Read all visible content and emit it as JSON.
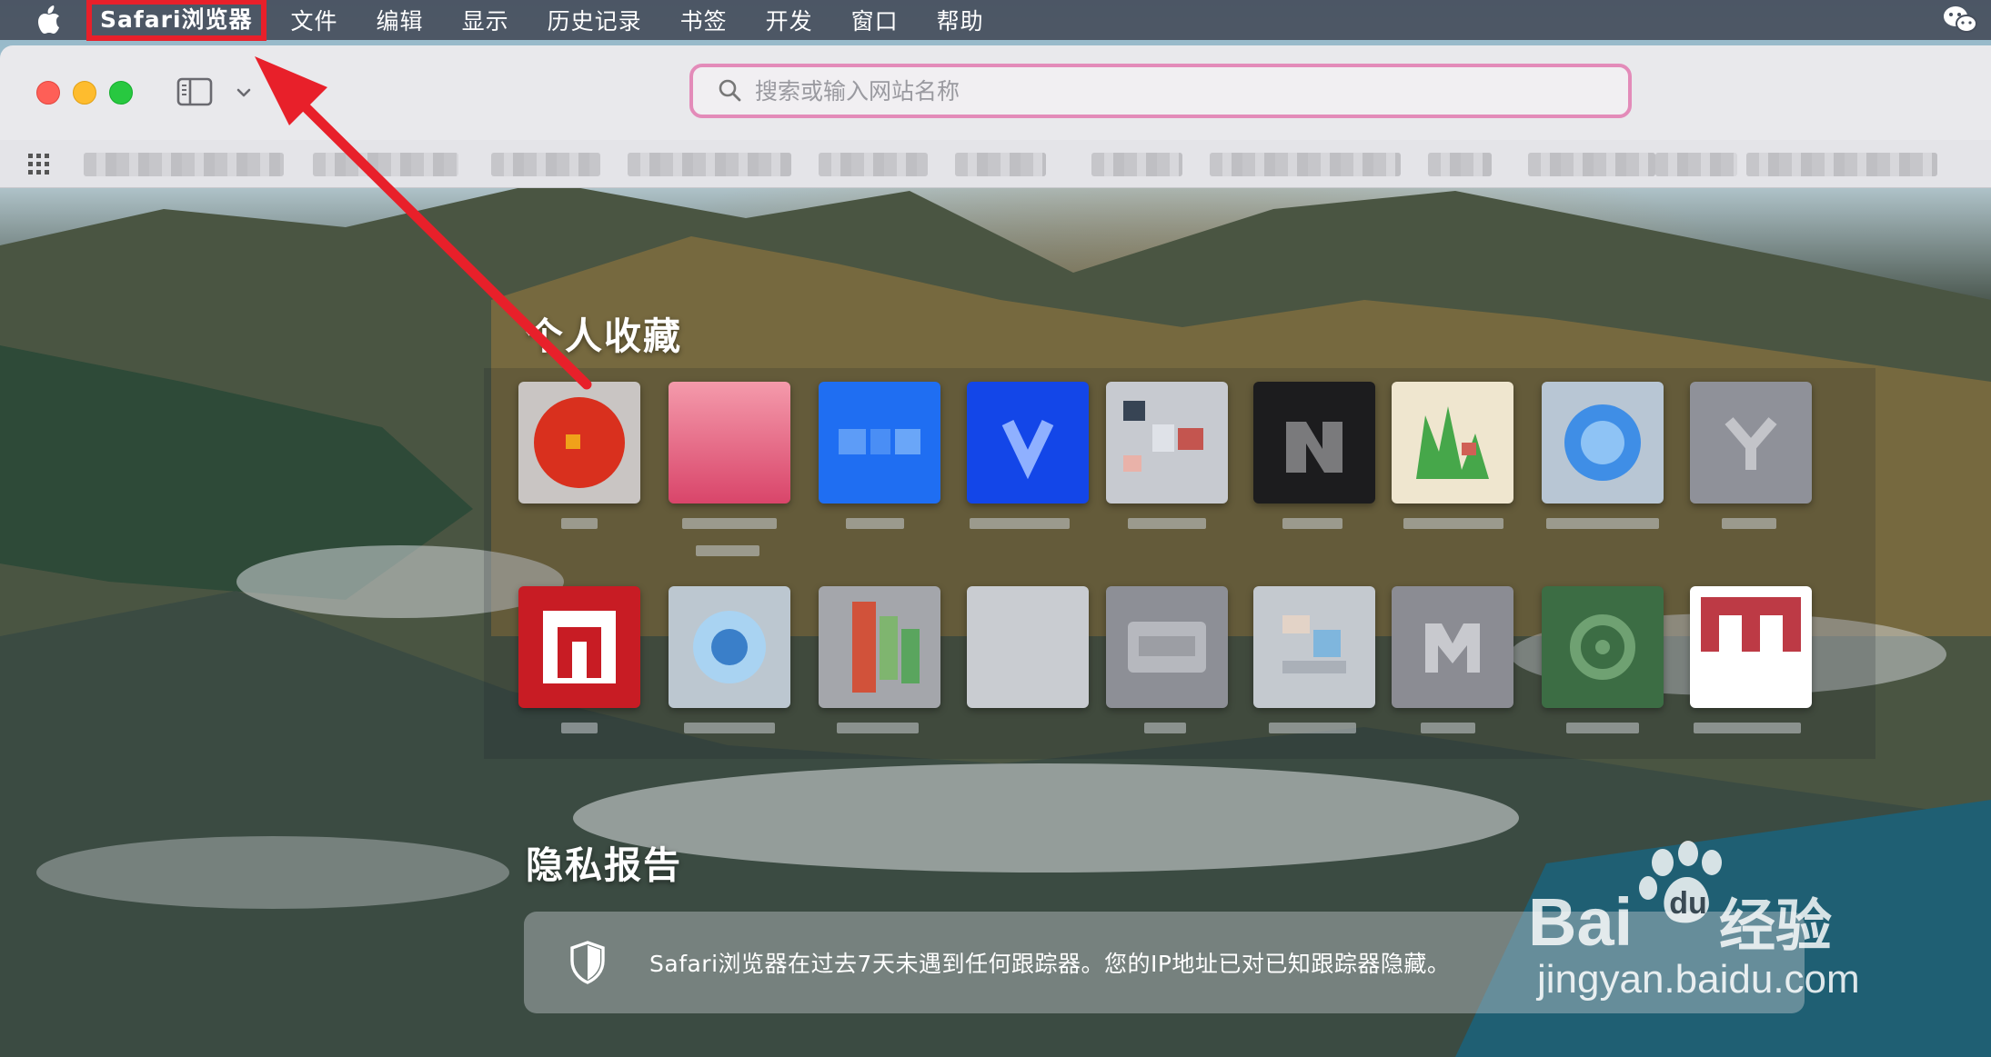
{
  "menubar": {
    "app_name": "Safari浏览器",
    "items": [
      "文件",
      "编辑",
      "显示",
      "历史记录",
      "书签",
      "开发",
      "窗口",
      "帮助"
    ]
  },
  "toolbar": {
    "search_placeholder": "搜索或输入网站名称"
  },
  "start_page": {
    "favorites_title": "个人收藏",
    "privacy_title": "隐私报告",
    "privacy_message": "Safari浏览器在过去7天未遇到任何跟踪器。您的IP地址已对已知跟踪器隐藏。"
  },
  "watermark": {
    "brand": "Bai du 经验",
    "url": "jingyan.baidu.com"
  },
  "colors": {
    "annotation_red": "#e8202a",
    "address_focus": "#e38bb9"
  }
}
